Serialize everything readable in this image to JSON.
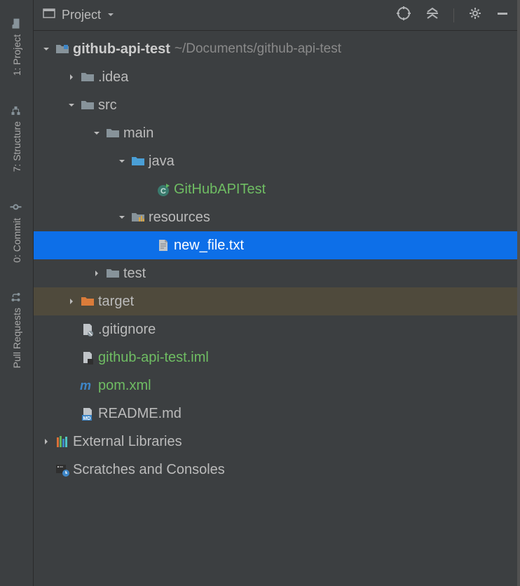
{
  "header": {
    "title": "Project"
  },
  "rail": {
    "project": "1: Project",
    "structure": "7: Structure",
    "commit": "0: Commit",
    "pull": "Pull Requests"
  },
  "tree": {
    "root": "github-api-test",
    "root_path": "~/Documents/github-api-test",
    "idea": ".idea",
    "src": "src",
    "main": "main",
    "java": "java",
    "classname": "GitHubAPITest",
    "resources": "resources",
    "newfile": "new_file.txt",
    "test": "test",
    "target": "target",
    "gitignore": ".gitignore",
    "iml": "github-api-test.iml",
    "pom": "pom.xml",
    "readme": "README.md",
    "external": "External Libraries",
    "scratches": "Scratches and Consoles"
  }
}
